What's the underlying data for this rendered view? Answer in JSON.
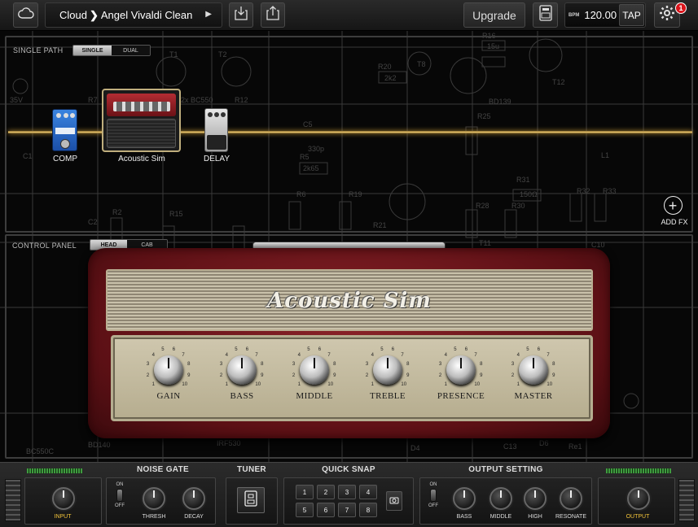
{
  "topbar": {
    "preset_source": "Cloud",
    "preset_name": "Angel Vivaldi Clean",
    "upgrade_label": "Upgrade",
    "bpm_label": "BPM",
    "bpm_value": "120.00",
    "tap_label": "TAP",
    "notification_count": "1"
  },
  "signal_path": {
    "section_label": "SINGLE PATH",
    "mode_options": [
      "SINGLE",
      "DUAL"
    ],
    "selected_mode": "SINGLE",
    "effects": [
      {
        "label": "COMP"
      },
      {
        "label": "Acoustic Sim"
      },
      {
        "label": "DELAY"
      }
    ],
    "add_fx_label": "ADD FX"
  },
  "control_panel": {
    "section_label": "CONTROL PANEL",
    "tabs": [
      "HEAD",
      "CAB"
    ],
    "selected_tab": "HEAD"
  },
  "amp": {
    "name": "Acoustic Sim",
    "knobs": [
      {
        "label": "GAIN"
      },
      {
        "label": "BASS"
      },
      {
        "label": "MIDDLE"
      },
      {
        "label": "TREBLE"
      },
      {
        "label": "PRESENCE"
      },
      {
        "label": "MASTER"
      }
    ],
    "scale_marks": [
      "1",
      "2",
      "3",
      "4",
      "5",
      "6",
      "7",
      "8",
      "9",
      "10"
    ]
  },
  "bottombar": {
    "input_label": "INPUT",
    "noise_gate": {
      "title": "NOISE GATE",
      "on": "ON",
      "off": "OFF",
      "thresh": "THRESH",
      "decay": "DECAY"
    },
    "tuner": {
      "title": "TUNER"
    },
    "quick_snap": {
      "title": "QUICK SNAP",
      "slots": [
        "1",
        "2",
        "3",
        "4",
        "5",
        "6",
        "7",
        "8"
      ]
    },
    "output_setting": {
      "title": "OUTPUT SETTING",
      "on": "ON",
      "off": "OFF",
      "bass": "BASS",
      "middle": "MIDDLE",
      "high": "HIGH",
      "resonate": "RESONATE"
    },
    "output_label": "OUTPUT"
  },
  "schematic_labels": [
    "35V",
    "BC550C",
    "2x BC550",
    "BD139",
    "BD140",
    "C5",
    "330p",
    "2k2",
    "15u",
    "T1",
    "T2",
    "T8",
    "T12",
    "R16",
    "R20",
    "R25",
    "R31",
    "150Ω",
    "R32",
    "R33",
    "L1",
    "IRF530",
    "C10",
    "C13",
    "R21",
    "T11",
    "D4",
    "D6",
    "Re1",
    "R6",
    "R19",
    "R28",
    "R30",
    "R15",
    "R2",
    "C2",
    "C1",
    "R7",
    "R12",
    "R5",
    "2k65"
  ],
  "colors": {
    "amp_body": "#7a1b21",
    "accent_cable": "#f3d27a",
    "badge": "#d9141b"
  }
}
